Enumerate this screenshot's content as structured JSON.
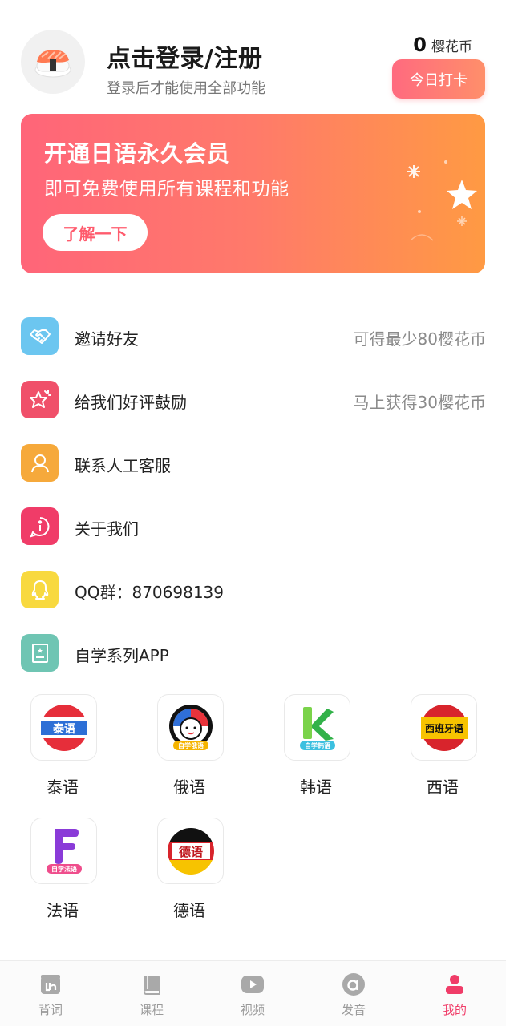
{
  "header": {
    "login_title": "点击登录/注册",
    "login_subtitle": "登录后才能使用全部功能",
    "coin_count": "0",
    "coin_unit": "樱花币",
    "checkin_label": "今日打卡"
  },
  "banner": {
    "title": "开通日语永久会员",
    "subtitle": "即可免费使用所有课程和功能",
    "button_label": "了解一下"
  },
  "menu": {
    "items": [
      {
        "label": "邀请好友",
        "hint": "可得最少80樱花币",
        "icon": "handshake-icon",
        "color": "#6cc6f0"
      },
      {
        "label": "给我们好评鼓励",
        "hint": "马上获得30樱花币",
        "icon": "star-icon",
        "color": "#f0506a"
      },
      {
        "label": "联系人工客服",
        "hint": "",
        "icon": "person-icon",
        "color": "#f6a93b"
      },
      {
        "label": "关于我们",
        "hint": "",
        "icon": "info-icon",
        "color": "#f03c68"
      },
      {
        "label": "QQ群：870698139",
        "hint": "",
        "icon": "qq-icon",
        "color": "#f8d93f"
      },
      {
        "label": "自学系列APP",
        "hint": "",
        "icon": "certificate-icon",
        "color": "#6fc5b3"
      }
    ]
  },
  "apps": [
    {
      "label": "泰语",
      "icon_text": "泰语"
    },
    {
      "label": "俄语",
      "icon_text": "自学俄语"
    },
    {
      "label": "韩语",
      "icon_text": "自学韩语"
    },
    {
      "label": "西语",
      "icon_text": "西班牙语"
    },
    {
      "label": "法语",
      "icon_text": "自学法语"
    },
    {
      "label": "德语",
      "icon_text": "德语"
    }
  ],
  "tabbar": {
    "tabs": [
      {
        "label": "背词",
        "icon": "vocab-icon"
      },
      {
        "label": "课程",
        "icon": "book-icon"
      },
      {
        "label": "视频",
        "icon": "play-icon"
      },
      {
        "label": "发音",
        "icon": "pronunciation-icon"
      },
      {
        "label": "我的",
        "icon": "profile-icon",
        "active": true
      }
    ]
  },
  "colors": {
    "accent": "#f03c68",
    "banner_start": "#ff6579",
    "banner_end": "#ff9a43"
  }
}
